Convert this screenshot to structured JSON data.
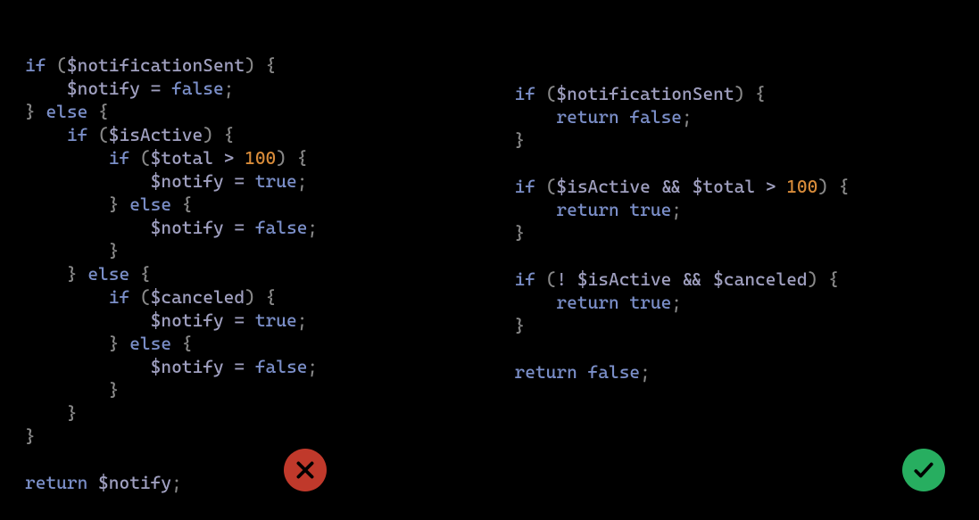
{
  "colors": {
    "keyword": "#7b8fc9",
    "variable": "#a0a0c0",
    "number": "#d98c3a",
    "badgeBad": "#c0392b",
    "badgeGood": "#27ae60"
  },
  "left": {
    "badge": "cross",
    "tokens": [
      [
        [
          "kw",
          "if"
        ],
        [
          "punct",
          " ("
        ],
        [
          "var",
          "$notificationSent"
        ],
        [
          "punct",
          ") {"
        ]
      ],
      [
        [
          "txt",
          "    "
        ],
        [
          "var",
          "$notify"
        ],
        [
          "operator",
          " = "
        ],
        [
          "bool",
          "false"
        ],
        [
          "punct",
          ";"
        ]
      ],
      [
        [
          "punct",
          "} "
        ],
        [
          "kw",
          "else"
        ],
        [
          "punct",
          " {"
        ]
      ],
      [
        [
          "txt",
          "    "
        ],
        [
          "kw",
          "if"
        ],
        [
          "punct",
          " ("
        ],
        [
          "var",
          "$isActive"
        ],
        [
          "punct",
          ") {"
        ]
      ],
      [
        [
          "txt",
          "        "
        ],
        [
          "kw",
          "if"
        ],
        [
          "punct",
          " ("
        ],
        [
          "var",
          "$total"
        ],
        [
          "operator",
          " > "
        ],
        [
          "num",
          "100"
        ],
        [
          "punct",
          ") {"
        ]
      ],
      [
        [
          "txt",
          "            "
        ],
        [
          "var",
          "$notify"
        ],
        [
          "operator",
          " = "
        ],
        [
          "bool",
          "true"
        ],
        [
          "punct",
          ";"
        ]
      ],
      [
        [
          "txt",
          "        "
        ],
        [
          "punct",
          "} "
        ],
        [
          "kw",
          "else"
        ],
        [
          "punct",
          " {"
        ]
      ],
      [
        [
          "txt",
          "            "
        ],
        [
          "var",
          "$notify"
        ],
        [
          "operator",
          " = "
        ],
        [
          "bool",
          "false"
        ],
        [
          "punct",
          ";"
        ]
      ],
      [
        [
          "txt",
          "        "
        ],
        [
          "punct",
          "}"
        ]
      ],
      [
        [
          "txt",
          "    "
        ],
        [
          "punct",
          "} "
        ],
        [
          "kw",
          "else"
        ],
        [
          "punct",
          " {"
        ]
      ],
      [
        [
          "txt",
          "        "
        ],
        [
          "kw",
          "if"
        ],
        [
          "punct",
          " ("
        ],
        [
          "var",
          "$canceled"
        ],
        [
          "punct",
          ") {"
        ]
      ],
      [
        [
          "txt",
          "            "
        ],
        [
          "var",
          "$notify"
        ],
        [
          "operator",
          " = "
        ],
        [
          "bool",
          "true"
        ],
        [
          "punct",
          ";"
        ]
      ],
      [
        [
          "txt",
          "        "
        ],
        [
          "punct",
          "} "
        ],
        [
          "kw",
          "else"
        ],
        [
          "punct",
          " {"
        ]
      ],
      [
        [
          "txt",
          "            "
        ],
        [
          "var",
          "$notify"
        ],
        [
          "operator",
          " = "
        ],
        [
          "bool",
          "false"
        ],
        [
          "punct",
          ";"
        ]
      ],
      [
        [
          "txt",
          "        "
        ],
        [
          "punct",
          "}"
        ]
      ],
      [
        [
          "txt",
          "    "
        ],
        [
          "punct",
          "}"
        ]
      ],
      [
        [
          "punct",
          "}"
        ]
      ],
      [
        [
          "txt",
          " "
        ]
      ],
      [
        [
          "kw",
          "return"
        ],
        [
          "txt",
          " "
        ],
        [
          "var",
          "$notify"
        ],
        [
          "punct",
          ";"
        ]
      ]
    ]
  },
  "right": {
    "badge": "check",
    "tokens": [
      [
        [
          "kw",
          "if"
        ],
        [
          "punct",
          " ("
        ],
        [
          "var",
          "$notificationSent"
        ],
        [
          "punct",
          ") {"
        ]
      ],
      [
        [
          "txt",
          "    "
        ],
        [
          "kw",
          "return"
        ],
        [
          "txt",
          " "
        ],
        [
          "bool",
          "false"
        ],
        [
          "punct",
          ";"
        ]
      ],
      [
        [
          "punct",
          "}"
        ]
      ],
      [
        [
          "txt",
          " "
        ]
      ],
      [
        [
          "kw",
          "if"
        ],
        [
          "punct",
          " ("
        ],
        [
          "var",
          "$isActive"
        ],
        [
          "operator",
          " && "
        ],
        [
          "var",
          "$total"
        ],
        [
          "operator",
          " > "
        ],
        [
          "num",
          "100"
        ],
        [
          "punct",
          ") {"
        ]
      ],
      [
        [
          "txt",
          "    "
        ],
        [
          "kw",
          "return"
        ],
        [
          "txt",
          " "
        ],
        [
          "bool",
          "true"
        ],
        [
          "punct",
          ";"
        ]
      ],
      [
        [
          "punct",
          "}"
        ]
      ],
      [
        [
          "txt",
          " "
        ]
      ],
      [
        [
          "kw",
          "if"
        ],
        [
          "punct",
          " ("
        ],
        [
          "operator",
          "! "
        ],
        [
          "var",
          "$isActive"
        ],
        [
          "operator",
          " && "
        ],
        [
          "var",
          "$canceled"
        ],
        [
          "punct",
          ") {"
        ]
      ],
      [
        [
          "txt",
          "    "
        ],
        [
          "kw",
          "return"
        ],
        [
          "txt",
          " "
        ],
        [
          "bool",
          "true"
        ],
        [
          "punct",
          ";"
        ]
      ],
      [
        [
          "punct",
          "}"
        ]
      ],
      [
        [
          "txt",
          " "
        ]
      ],
      [
        [
          "kw",
          "return"
        ],
        [
          "txt",
          " "
        ],
        [
          "bool",
          "false"
        ],
        [
          "punct",
          ";"
        ]
      ]
    ]
  }
}
